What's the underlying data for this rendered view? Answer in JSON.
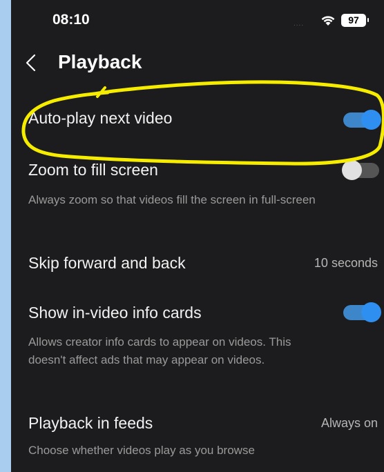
{
  "status_bar": {
    "time": "08:10",
    "signal_dots": "....",
    "wifi_icon": "wifi-icon",
    "battery": "97"
  },
  "header": {
    "back_icon": "chevron-left-icon",
    "title": "Playback"
  },
  "settings": [
    {
      "title": "Auto-play next video",
      "toggle": true
    },
    {
      "title": "Zoom to fill screen",
      "subtitle": "Always zoom so that videos fill the screen in full-screen",
      "toggle": false
    },
    {
      "title": "Skip forward and back",
      "value": "10 seconds"
    },
    {
      "title": "Show in-video info cards",
      "subtitle": "Allows creator info cards to appear on videos. This doesn't affect ads that may appear on videos.",
      "toggle": true
    },
    {
      "title": "Playback in feeds",
      "subtitle": "Choose whether videos play as you browse",
      "value": "Always on"
    }
  ],
  "colors": {
    "background": "#1c1c1e",
    "toggle_on": "#2f8ff0",
    "highlight_annotation": "#f5ec00"
  }
}
